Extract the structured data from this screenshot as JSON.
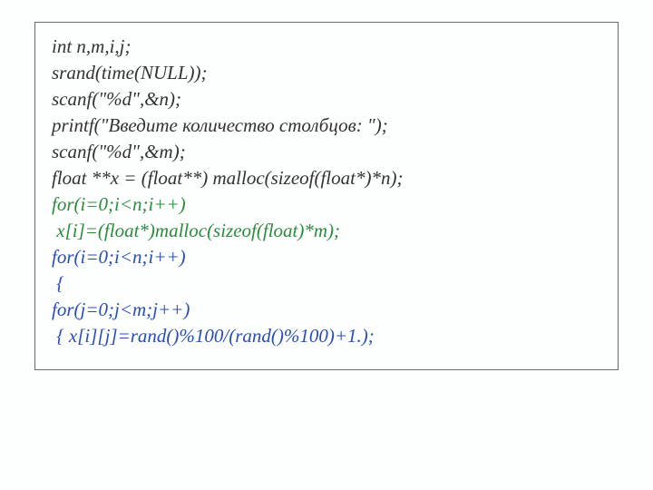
{
  "code": {
    "lines": [
      {
        "text": "int n,m,i,j;",
        "class": ""
      },
      {
        "text": "srand(time(NULL));",
        "class": ""
      },
      {
        "text": "scanf(\"%d\",&n);",
        "class": ""
      },
      {
        "text": "printf(\"Введите количество столбцов: \");",
        "class": ""
      },
      {
        "text": "scanf(\"%d\",&m);",
        "class": ""
      },
      {
        "text": "float **x = (float**) malloc(sizeof(float*)*n);",
        "class": ""
      },
      {
        "text": "for(i=0;i<n;i++)",
        "class": "green"
      },
      {
        "text": " x[i]=(float*)malloc(sizeof(float)*m);",
        "class": "green"
      },
      {
        "text": "for(i=0;i<n;i++)",
        "class": "blue"
      },
      {
        "text": " {",
        "class": "blue"
      },
      {
        "text": "for(j=0;j<m;j++)",
        "class": "blue"
      },
      {
        "text": " { x[i][j]=rand()%100/(rand()%100)+1.);",
        "class": "blue"
      }
    ]
  }
}
